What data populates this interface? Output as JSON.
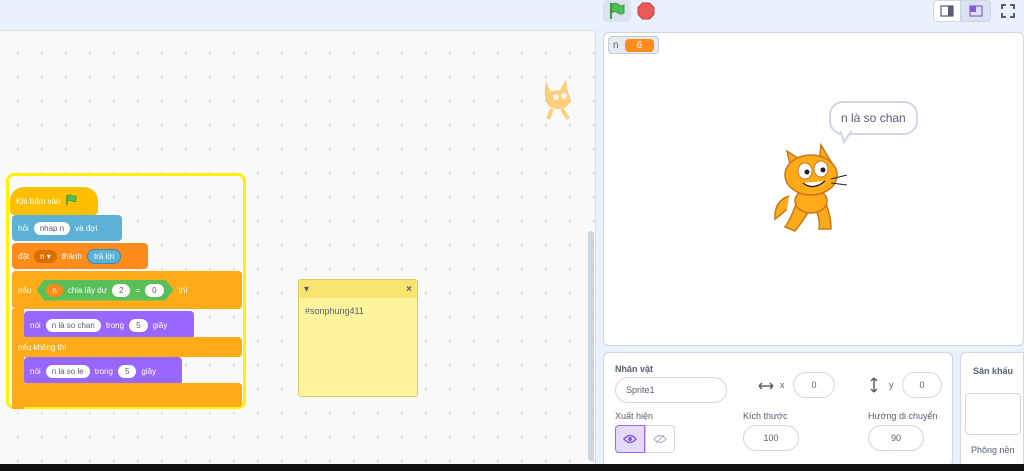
{
  "toolbar": {
    "green_flag_icon": "green-flag-icon",
    "stop_icon": "stop-icon",
    "small_stage_icon": "small-stage-icon",
    "large_stage_icon": "large-stage-icon",
    "fullscreen_icon": "fullscreen-icon"
  },
  "code": {
    "hat": {
      "label": "Khi bấm vào"
    },
    "ask": {
      "label": "hỏi",
      "input": "nhap n",
      "tail": "và đợi"
    },
    "set": {
      "label": "đặt",
      "var": "n ▾",
      "to": "thành",
      "value": "trả lời"
    },
    "if": {
      "label": "nếu",
      "var": "n",
      "op": "chia lấy dư",
      "divisor": "2",
      "eq": "=",
      "rhs": "0",
      "then": "thì"
    },
    "say1": {
      "label": "nói",
      "text": "n là so chan",
      "for": "trong",
      "secs": "5",
      "unit": "giây"
    },
    "else": {
      "label": "nếu không thì"
    },
    "say2": {
      "label": "nói",
      "text": "n la so le",
      "for": "trong",
      "secs": "5",
      "unit": "giây"
    },
    "note": {
      "text": "#sonphung411",
      "close": "×",
      "collapse": "▾"
    }
  },
  "stage": {
    "monitor": {
      "name": "n",
      "value": "6"
    },
    "speech": "n là so chan"
  },
  "sprite_panel": {
    "title": "Nhân vật",
    "name": "Sprite1",
    "x_label": "x",
    "x_value": "0",
    "y_label": "y",
    "y_value": "0",
    "show_label": "Xuất hiện",
    "size_label": "Kích thước",
    "size_value": "100",
    "direction_label": "Hướng di chuyển",
    "direction_value": "90"
  },
  "stage_panel": {
    "title": "Sân khấu",
    "backdrops_label": "Phông nền"
  },
  "colors": {
    "events": "#ffbf00",
    "sensing": "#5cb1d6",
    "variables": "#ff8c1a",
    "control": "#ffab19",
    "operators": "#59c059",
    "looks": "#9966ff",
    "highlight": "#fff200"
  }
}
